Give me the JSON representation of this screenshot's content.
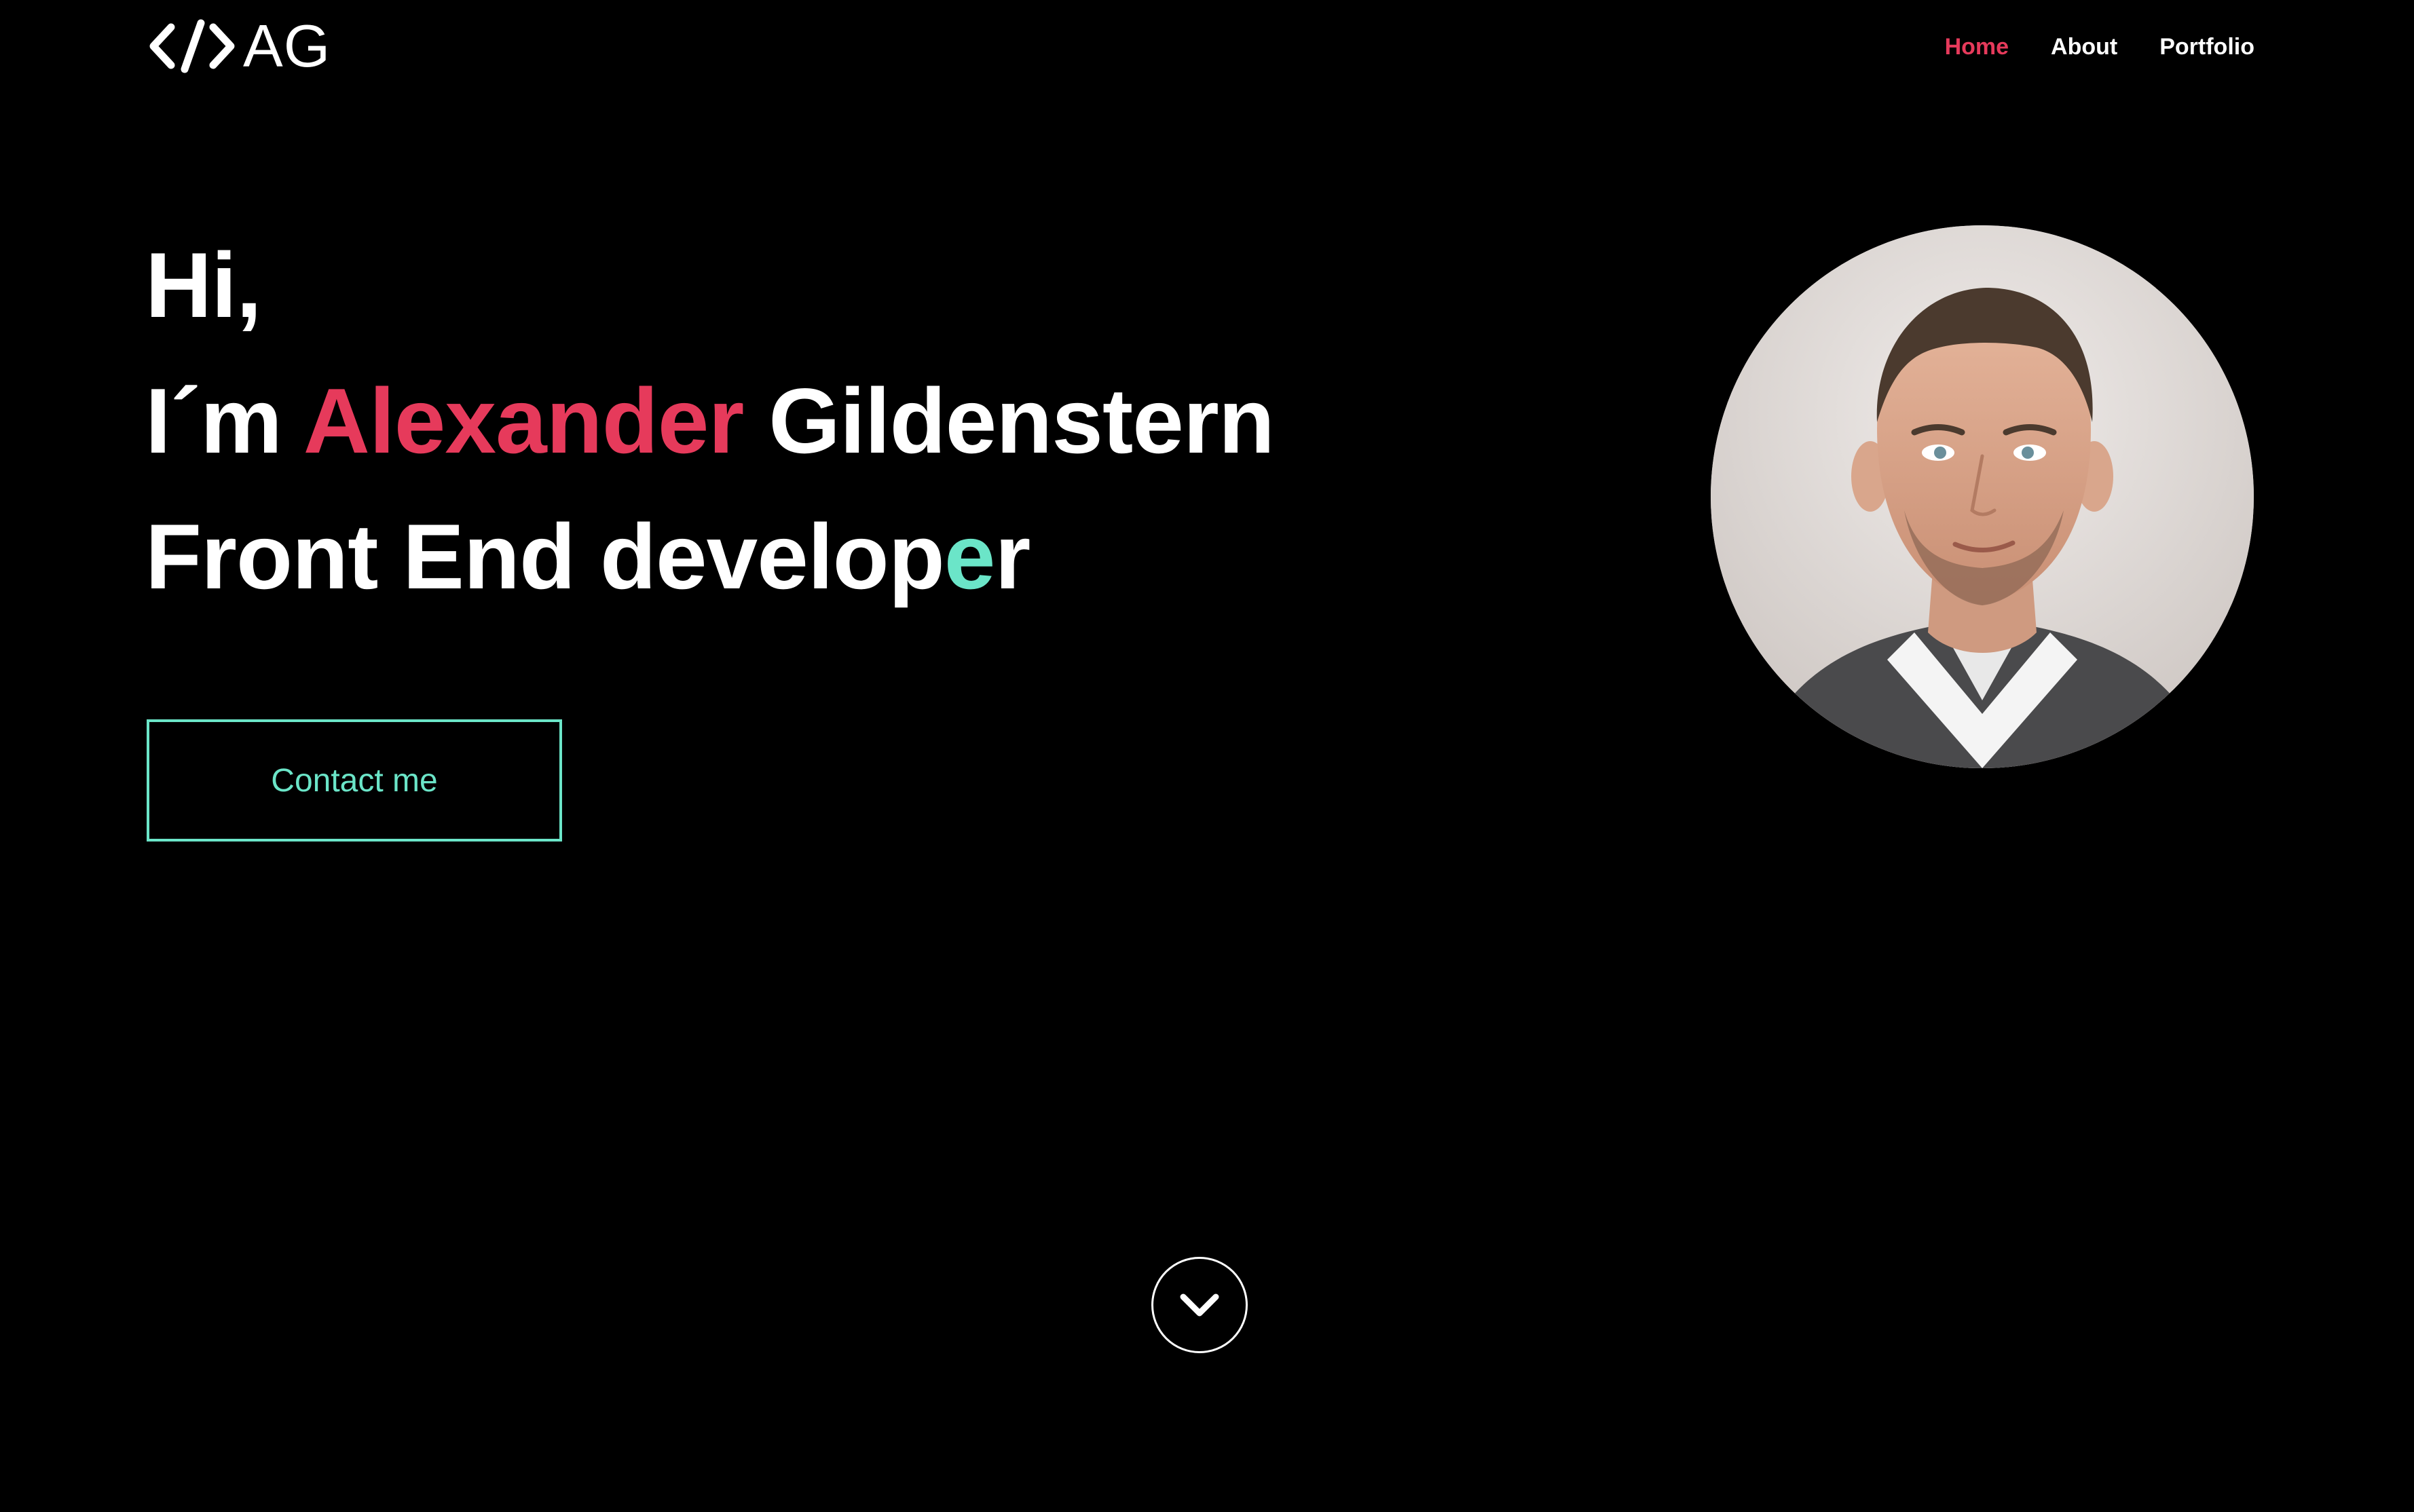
{
  "header": {
    "logo": {
      "icon": "code-brackets-icon",
      "text": "AG"
    },
    "nav": {
      "items": [
        {
          "label": "Home",
          "active": true
        },
        {
          "label": "About",
          "active": false
        },
        {
          "label": "Portfolio",
          "active": false
        }
      ]
    }
  },
  "hero": {
    "greeting": "Hi,",
    "intro_prefix": "I´m",
    "first_name": "Alexander",
    "last_name": "Gildenstern",
    "role_start": "Front End develop",
    "role_highlight": "e",
    "role_end": "r",
    "contact_label": "Contact me"
  },
  "avatar": {
    "icon": "profile-photo"
  },
  "scroll": {
    "icon": "chevron-down-icon"
  },
  "colors": {
    "background": "#000000",
    "text": "#ffffff",
    "accent_red": "#e63a5b",
    "accent_teal": "#6be5c8"
  }
}
